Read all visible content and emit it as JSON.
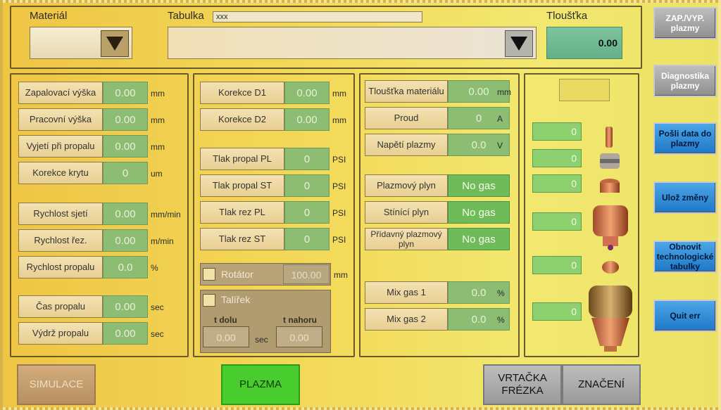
{
  "header": {
    "material_label": "Materiál",
    "tabulka_label": "Tabulka",
    "tabulka_value": "xxx",
    "thickness_label": "Tloušťka",
    "thickness_value": "0.00"
  },
  "left_panel": {
    "rows": [
      {
        "label": "Zapalovací výška",
        "value": "0.00",
        "unit": "mm"
      },
      {
        "label": "Pracovní výška",
        "value": "0.00",
        "unit": "mm"
      },
      {
        "label": "Vyjetí při propalu",
        "value": "0.00",
        "unit": "mm"
      },
      {
        "label": "Korekce krytu",
        "value": "0",
        "unit": "um"
      },
      {
        "label": "Rychlost sjetí",
        "value": "0.00",
        "unit": "mm/min"
      },
      {
        "label": "Rychlost řez.",
        "value": "0.00",
        "unit": "m/min"
      },
      {
        "label": "Rychlost propalu",
        "value": "0.0",
        "unit": "%"
      },
      {
        "label": "Čas propalu",
        "value": "0.00",
        "unit": "sec"
      },
      {
        "label": "Výdrž propalu",
        "value": "0.00",
        "unit": "sec"
      }
    ]
  },
  "mid_panel": {
    "rows": [
      {
        "label": "Korekce D1",
        "value": "0.00",
        "unit": "mm"
      },
      {
        "label": "Korekce D2",
        "value": "0.00",
        "unit": "mm"
      },
      {
        "label": "Tlak propal PL",
        "value": "0",
        "unit": "PSI"
      },
      {
        "label": "Tlak propal ST",
        "value": "0",
        "unit": "PSI"
      },
      {
        "label": "Tlak rez PL",
        "value": "0",
        "unit": "PSI"
      },
      {
        "label": "Tlak rez ST",
        "value": "0",
        "unit": "PSI"
      }
    ],
    "rotator": {
      "label": "Rotátor",
      "value": "100.00",
      "unit": "mm"
    },
    "talirek": {
      "label": "Talířek",
      "t_dolu_label": "t dolu",
      "t_nahoru_label": "t nahoru",
      "t_dolu_value": "0.00",
      "t_nahoru_value": "0.00",
      "unit": "sec"
    }
  },
  "right_panel": {
    "rows": [
      {
        "label": "Tloušťka materiálu",
        "value": "0.00",
        "unit": "mm"
      },
      {
        "label": "Proud",
        "value": "0",
        "unit": "A"
      },
      {
        "label": "Napětí plazmy",
        "value": "0.0",
        "unit": "V"
      },
      {
        "label": "Plazmový plyn",
        "value": "No gas",
        "unit": ""
      },
      {
        "label": "Stínící plyn",
        "value": "No gas",
        "unit": ""
      },
      {
        "label": "Přídavný plazmový plyn",
        "value": "No gas",
        "unit": ""
      },
      {
        "label": "Mix gas 1",
        "value": "0.0",
        "unit": "%"
      },
      {
        "label": "Mix gas 2",
        "value": "0.0",
        "unit": "%"
      }
    ]
  },
  "parts_panel": {
    "counters": [
      "0",
      "0",
      "0",
      "0",
      "0",
      "0"
    ]
  },
  "side_buttons": [
    {
      "label": "ZAP./VYP. plazmy"
    },
    {
      "label": "Diagnostika plazmy"
    },
    {
      "label": "Pošli data do plazmy"
    },
    {
      "label": "Ulož změny"
    },
    {
      "label": "Obnovit technologické tabulky"
    },
    {
      "label": "Quit err"
    }
  ],
  "bottom_buttons": {
    "simulace": "SIMULACE",
    "plazma": "PLAZMA",
    "vrtacka": "VRTAČKA FRÉZKA",
    "znaceni": "ZNAČENÍ"
  },
  "colors": {
    "accent_green": "#49cc2e",
    "value_green": "#8cbd72",
    "button_blue": "#2b8ad6",
    "button_grey": "#a6a6a6"
  }
}
